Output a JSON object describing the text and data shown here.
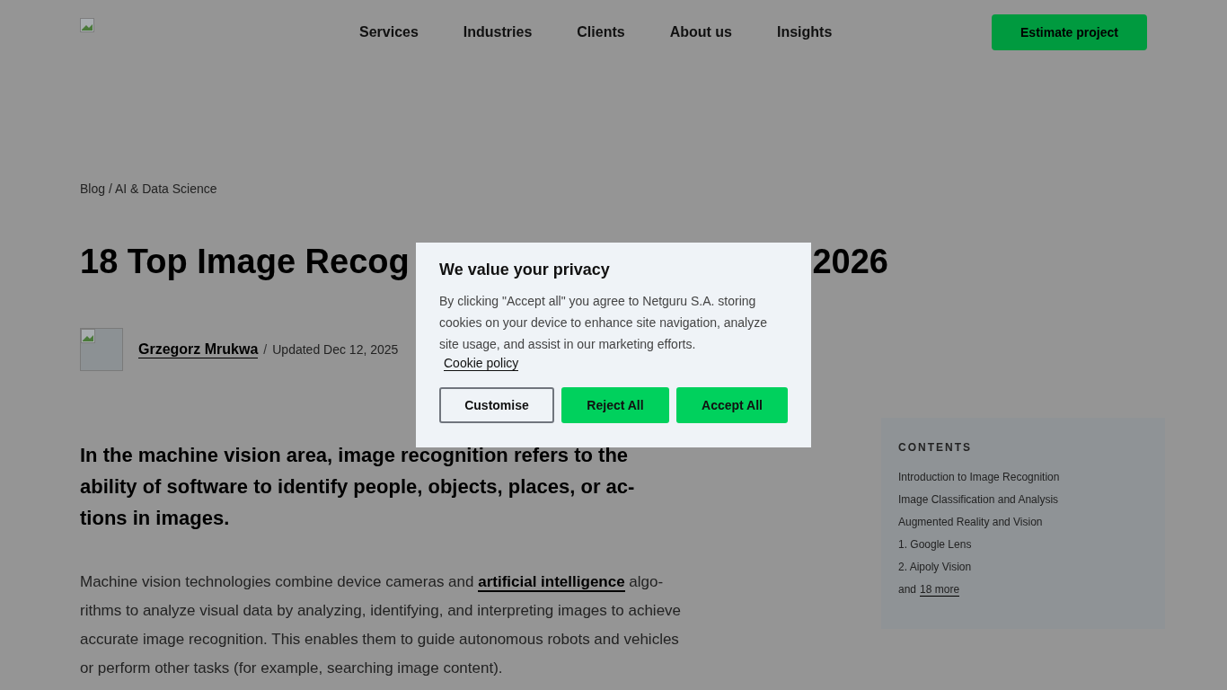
{
  "header": {
    "nav": [
      "Services",
      "Industries",
      "Clients",
      "About us",
      "Insights"
    ],
    "cta": "Estimate project"
  },
  "breadcrumb": "Blog / AI & Data Science",
  "title_parts": [
    "18 Top Image Recog",
    "2026"
  ],
  "author": {
    "name": "Grzegorz Mrukwa",
    "separator": "/",
    "updated": "Updated Dec 12, 2025"
  },
  "lead": "In the machine vision area, image recognition refers to the ability of software to identify people, objects, places, or ac-tions in images.",
  "body": {
    "before": "Machine vision technologies combine device cameras and",
    "link": "artificial intelligence",
    "after": "algo-rithms to analyze visual data by analyzing, identifying, and interpreting images to achieve accurate image recognition. This enables them to guide autonomous robots and vehicles or perform other tasks (for example, searching image content)."
  },
  "contents": {
    "heading": "CONTENTS",
    "items": [
      "Introduction to Image Recognition",
      "Image Classification and Analysis",
      "Augmented Reality and Vision",
      "1. Google Lens",
      "2. Aipoly Vision"
    ],
    "more_prefix": "and",
    "more_link": "18 more"
  },
  "cookie_dialog": {
    "title": "We value your privacy",
    "text": "By clicking \"Accept all\" you agree to Netguru S.A. storing cookies on your device to enhance site navigation, analyze site usage, and assist in our marketing efforts.",
    "policy_link": "Cookie policy",
    "buttons": [
      {
        "label": "Customise",
        "kind": "outline"
      },
      {
        "label": "Reject All",
        "kind": "primary"
      },
      {
        "label": "Accept All",
        "kind": "primary"
      }
    ]
  }
}
